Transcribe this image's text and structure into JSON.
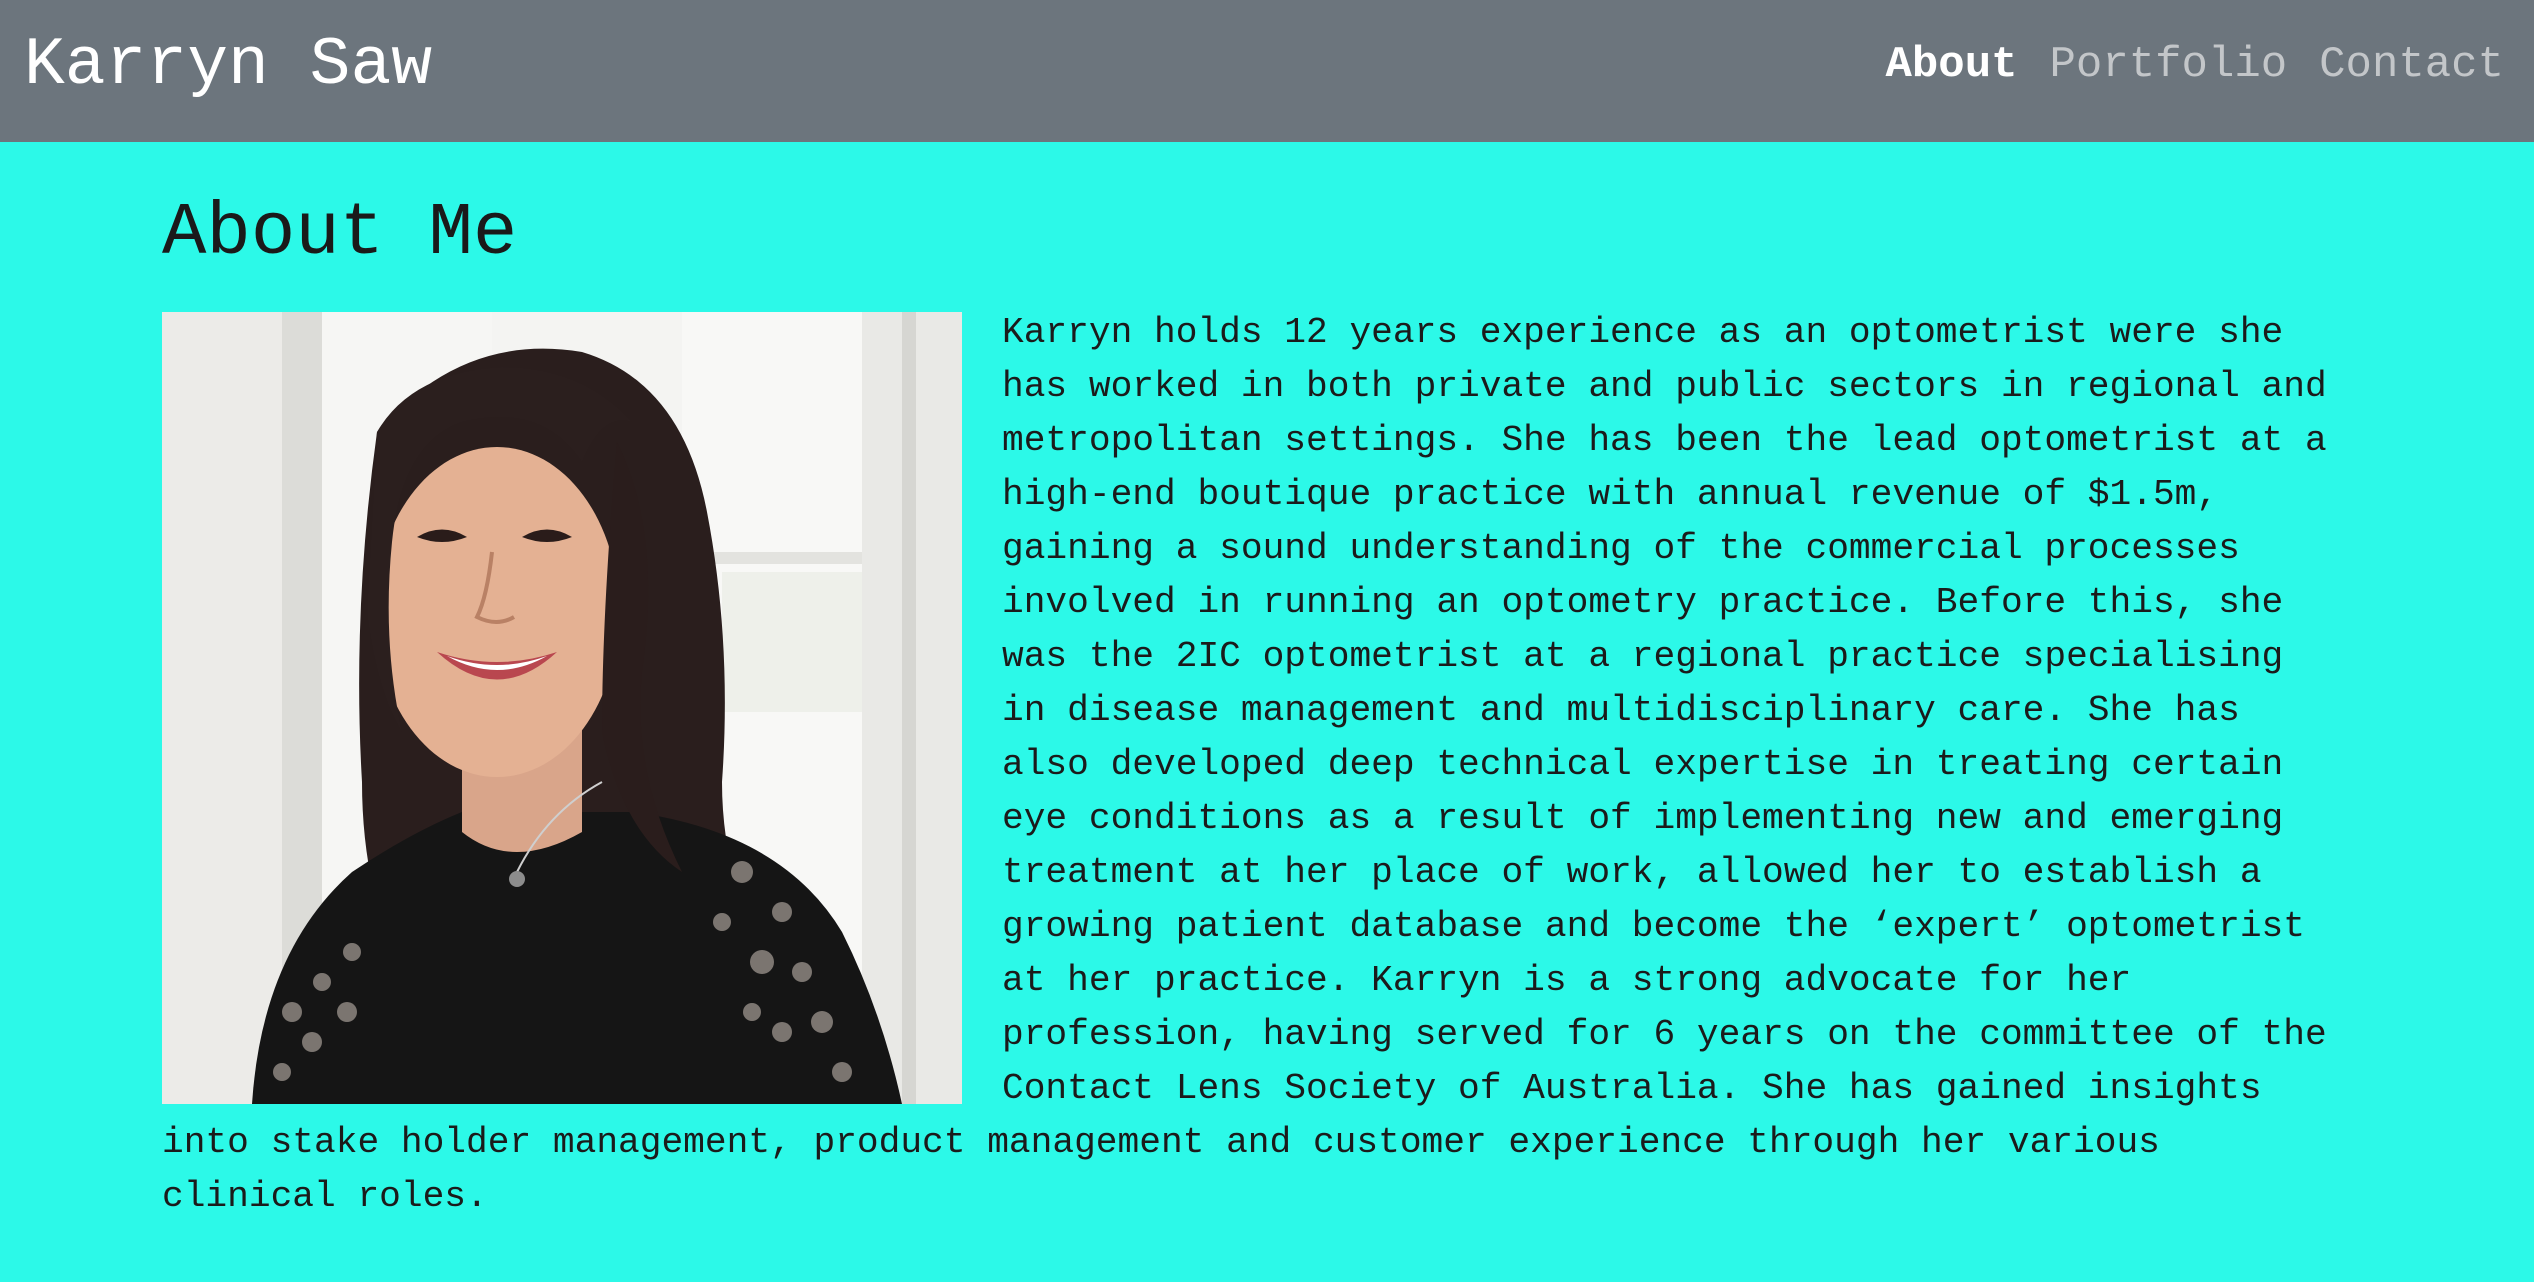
{
  "header": {
    "brand": "Karryn Saw",
    "nav": [
      {
        "label": "About",
        "active": true
      },
      {
        "label": "Portfolio",
        "active": false
      },
      {
        "label": "Contact",
        "active": false
      }
    ]
  },
  "main": {
    "title": "About Me",
    "bio": "Karryn holds 12 years experience as an optometrist were she has worked in both private and public sectors in regional and metropolitan settings. She has been the lead optometrist at a high-end boutique practice with annual revenue of $1.5m, gaining a sound understanding of the commercial processes involved in running an optometry practice. Before this, she was the 2IC optometrist at a regional practice specialising in disease management and multidisciplinary care. She has also developed deep technical expertise in treating certain eye conditions as a result of implementing new and emerging treatment at her place of work, allowed her to establish a growing patient database and become the ‘expert’ optometrist at her practice. Karryn is a strong advocate for her profession, having served for 6 years on the committee of the Contact Lens Society of Australia. She has gained insights into stake holder management, product management and customer experience through her various clinical roles."
  },
  "colors": {
    "page_background": "#2cf9e8",
    "navbar_background": "#6c757d",
    "nav_inactive": "#c3c6c9",
    "nav_active": "#ffffff"
  }
}
